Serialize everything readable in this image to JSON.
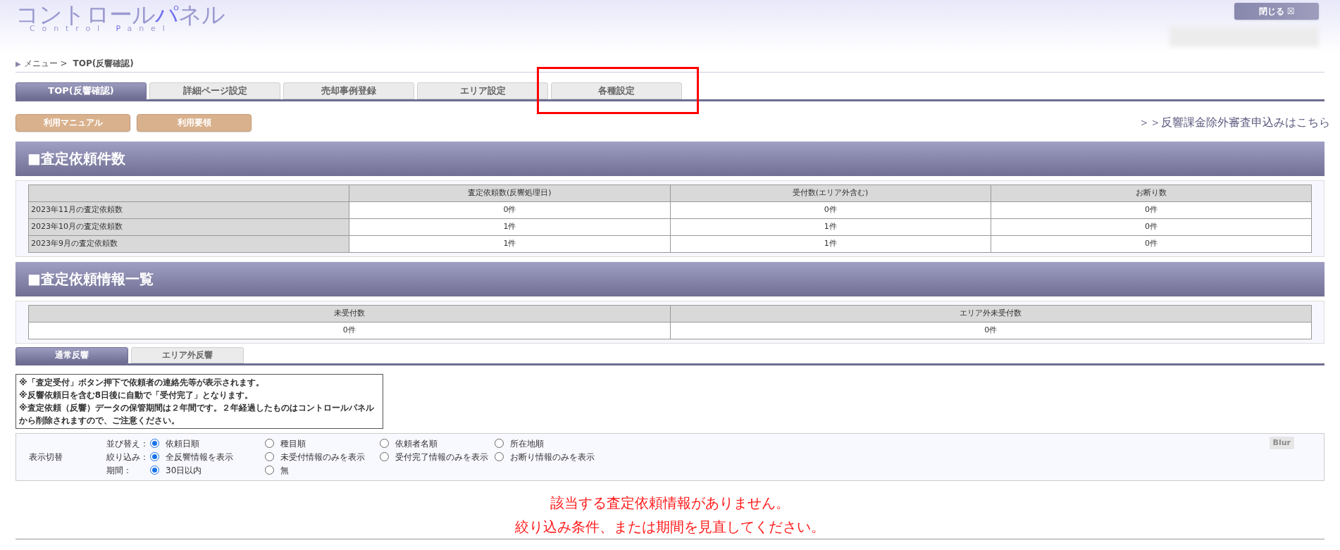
{
  "logo": {
    "title_main": "コントロール",
    "title_accent": "パ",
    "title_rest": "ネル",
    "subtitle_main": "Control ",
    "subtitle_accent": "P",
    "subtitle_rest": "anel"
  },
  "close_button": {
    "label": "閉じる",
    "icon": "☒"
  },
  "breadcrumb": {
    "marker": "▶",
    "path": "メニュー > ",
    "current": "TOP(反響確認)"
  },
  "tabs": [
    {
      "label": "TOP(反響確認)",
      "selected": true,
      "highlighted": false
    },
    {
      "label": "詳細ページ設定",
      "selected": false,
      "highlighted": false
    },
    {
      "label": "売却事例登録",
      "selected": false,
      "highlighted": false
    },
    {
      "label": "エリア設定",
      "selected": false,
      "highlighted": false
    },
    {
      "label": "各種設定",
      "selected": false,
      "highlighted": true
    }
  ],
  "action_buttons": [
    "利用マニュアル",
    "利用要領"
  ],
  "exemption_link": "＞＞反響課金除外審査申込みはこちら",
  "request_count_section": {
    "title": "■査定依頼件数",
    "columns": [
      "",
      "査定依頼数(反響処理日)",
      "受付数(エリア外含む)",
      "お断り数"
    ],
    "rows": [
      [
        "2023年11月の査定依頼数",
        "0件",
        "0件",
        "0件"
      ],
      [
        "2023年10月の査定依頼数",
        "1件",
        "1件",
        "0件"
      ],
      [
        "2023年9月の査定依頼数",
        "1件",
        "1件",
        "0件"
      ]
    ]
  },
  "request_list_section": {
    "title": "■査定依頼情報一覧",
    "columns": [
      "未受付数",
      "エリア外未受付数"
    ],
    "rows": [
      [
        "0件",
        "0件"
      ]
    ]
  },
  "response_tabs": [
    {
      "label": "通常反響",
      "selected": true
    },
    {
      "label": "エリア外反響",
      "selected": false
    }
  ],
  "notes": [
    "※「査定受付」ボタン押下で依頼者の連絡先等が表示されます。",
    "※反響依頼日を含む8日後に自動で「受付完了」となります。",
    "※査定依頼（反響）データの保管期間は２年間です。２年経過したものはコントロールパネルから削除されますので、ご注意ください。"
  ],
  "display_switch": {
    "label": "表示切替",
    "blur_button": "Blur",
    "groups": [
      {
        "label": "並び替え：",
        "options": [
          {
            "label": "依頼日順",
            "selected": true
          },
          {
            "label": "種目順",
            "selected": false
          },
          {
            "label": "依頼者名順",
            "selected": false
          },
          {
            "label": "所在地順",
            "selected": false
          }
        ]
      },
      {
        "label": "絞り込み：",
        "options": [
          {
            "label": "全反響情報を表示",
            "selected": true
          },
          {
            "label": "未受付情報のみを表示",
            "selected": false
          },
          {
            "label": "受付完了情報のみを表示",
            "selected": false
          },
          {
            "label": "お断り情報のみを表示",
            "selected": false
          }
        ]
      },
      {
        "label": "期間：",
        "options": [
          {
            "label": "30日以内",
            "selected": true
          },
          {
            "label": "無",
            "selected": false
          }
        ]
      }
    ]
  },
  "empty_message": [
    "該当する査定依頼情報がありません。",
    "絞り込み条件、または期間を見直してください。"
  ]
}
